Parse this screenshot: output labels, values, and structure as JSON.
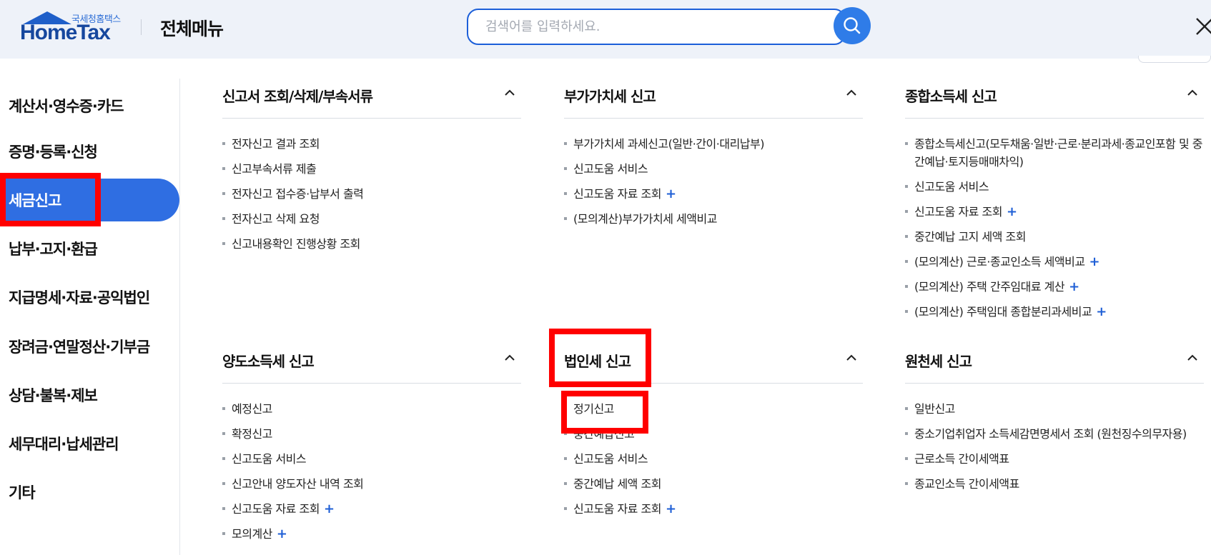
{
  "header": {
    "logo_sub": "국세청홈택스",
    "logo_text": "HomeTax",
    "title": "전체메뉴",
    "search_placeholder": "검색어를 입력하세요.",
    "search_value": ""
  },
  "sidebar": {
    "items": [
      {
        "label": "계산서·영수증·카드"
      },
      {
        "label": "증명·등록·신청"
      },
      {
        "label": "세금신고",
        "active": true
      },
      {
        "label": "납부·고지·환급"
      },
      {
        "label": "지급명세·자료·공익법인"
      },
      {
        "label": "장려금·연말정산·기부금"
      },
      {
        "label": "상담·불복·제보"
      },
      {
        "label": "세무대리·납세관리"
      },
      {
        "label": "기타"
      }
    ]
  },
  "sections": [
    {
      "title": "신고서 조회/삭제/부속서류",
      "items": [
        {
          "label": "전자신고 결과 조회"
        },
        {
          "label": "신고부속서류 제출"
        },
        {
          "label": "전자신고 접수증·납부서 출력"
        },
        {
          "label": "전자신고 삭제 요청"
        },
        {
          "label": "신고내용확인 진행상황 조회"
        }
      ]
    },
    {
      "title": "부가가치세 신고",
      "items": [
        {
          "label": "부가가치세 과세신고(일반·간이·대리납부)"
        },
        {
          "label": "신고도움 서비스"
        },
        {
          "label": "신고도움 자료 조회",
          "plus": "+"
        },
        {
          "label": "(모의계산)부가가치세 세액비교"
        }
      ]
    },
    {
      "title": "종합소득세 신고",
      "items": [
        {
          "label": "종합소득세신고(모두채움·일반·근로·분리과세·종교인포함 및 중간예납·토지등매매차익)"
        },
        {
          "label": "신고도움 서비스"
        },
        {
          "label": "신고도움 자료 조회",
          "plus": "+"
        },
        {
          "label": "중간예납 고지 세액 조회"
        },
        {
          "label": "(모의계산) 근로·종교인소득 세액비교",
          "plus": "+"
        },
        {
          "label": "(모의계산) 주택 간주임대료 계산",
          "plus": "+"
        },
        {
          "label": "(모의계산) 주택임대 종합분리과세비교",
          "plus": "+"
        }
      ]
    },
    {
      "title": "양도소득세 신고",
      "items": [
        {
          "label": "예정신고"
        },
        {
          "label": "확정신고"
        },
        {
          "label": "신고도움 서비스"
        },
        {
          "label": "신고안내 양도자산 내역 조회"
        },
        {
          "label": "신고도움 자료 조회",
          "plus": "+"
        },
        {
          "label": "모의계산",
          "plus": "+"
        }
      ]
    },
    {
      "title": "법인세 신고",
      "items": [
        {
          "label": "정기신고"
        },
        {
          "label": "중간예납신고"
        },
        {
          "label": "신고도움 서비스"
        },
        {
          "label": "중간예납 세액 조회"
        },
        {
          "label": "신고도움 자료 조회",
          "plus": "+"
        }
      ]
    },
    {
      "title": "원천세 신고",
      "items": [
        {
          "label": "일반신고"
        },
        {
          "label": "중소기업취업자 소득세감면명세서 조회 (원천징수의무자용)"
        },
        {
          "label": "근로소득 간이세액표"
        },
        {
          "label": "종교인소득 간이세액표"
        }
      ]
    }
  ],
  "colors": {
    "accent": "#2f6ee2",
    "highlight": "#ff0000",
    "logo": "#16479e"
  }
}
